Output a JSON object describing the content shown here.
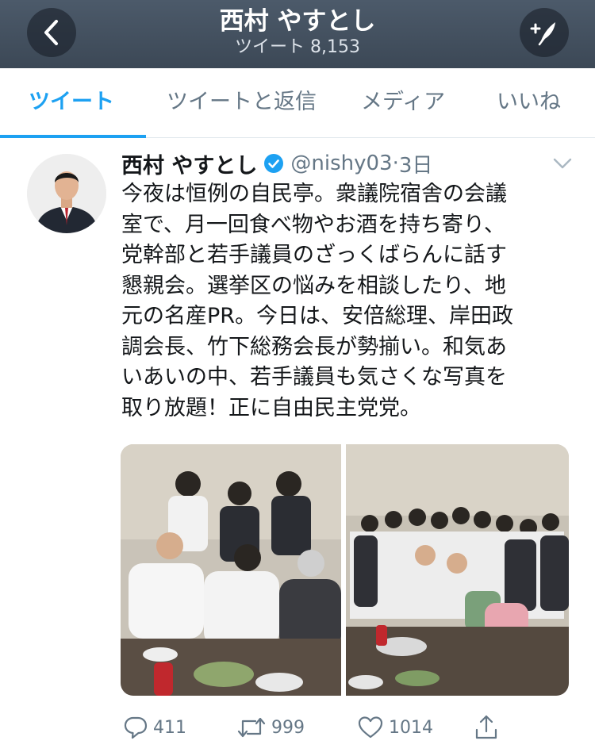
{
  "header": {
    "back_icon": "chevron-left-icon",
    "title": "西村 やすとし",
    "subtitle": "ツイート 8,153",
    "compose_icon": "compose-tweet-icon"
  },
  "tabs": [
    {
      "label": "ツイート",
      "active": true
    },
    {
      "label": "ツイートと返信",
      "active": false
    },
    {
      "label": "メディア",
      "active": false
    },
    {
      "label": "いいね",
      "active": false
    }
  ],
  "tweet": {
    "author_name": "西村 やすとし",
    "handle": "@nishy03",
    "separator": "·",
    "time": "3日",
    "text": "今夜は恒例の自民亭。衆議院宿舎の会議\n室で、月一回食べ物やお酒を持ち寄り、\n党幹部と若手議員のざっくばらんに話す\n懇親会。選挙区の悩みを相談したり、地\n元の名産PR。今日は、安倍総理、岸田政\n調会長、竹下総務会長が勢揃い。和気あ\nいあいの中、若手議員も気さくな写真を\n取り放題！正に自由民主党党。",
    "media": [
      {
        "icon": "photo-image",
        "description": "group photo left"
      },
      {
        "icon": "photo-image",
        "description": "group photo right"
      }
    ],
    "actions": {
      "reply_count": "411",
      "retweet_count": "999",
      "like_count": "1014"
    }
  },
  "colors": {
    "accent": "#1da1f2",
    "secondary_text": "#657786",
    "header_bg": "#45525f"
  }
}
